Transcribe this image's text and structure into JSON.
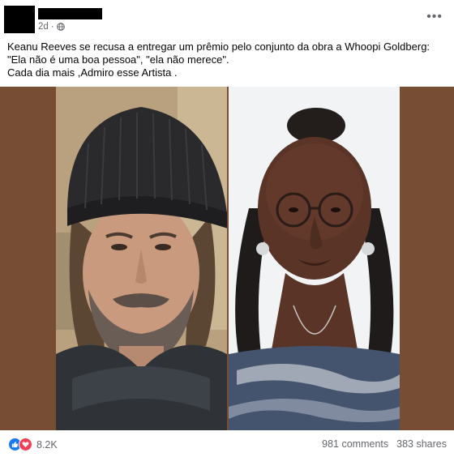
{
  "post": {
    "timestamp": "2d",
    "privacy_icon": "globe-icon",
    "more_icon": "more-options-icon",
    "text_line1": "Keanu Reeves se recusa a entregar um prêmio pelo conjunto da obra a Whoopi Goldberg: \"Ela não é uma boa pessoa\", \"ela não merece\".",
    "text_line2": "Cada dia mais ,Admiro esse Artista ."
  },
  "media": {
    "left_photo_icon": "person-photo",
    "right_photo_icon": "person-photo",
    "background_color": "#774d33"
  },
  "footer": {
    "reaction_icons": [
      "like-icon",
      "love-icon"
    ],
    "reaction_count": "8.2K",
    "comments": "981 comments",
    "shares": "383 shares"
  },
  "colors": {
    "like": "#1877f2",
    "love": "#f33e58",
    "secondary_text": "#65676b"
  }
}
